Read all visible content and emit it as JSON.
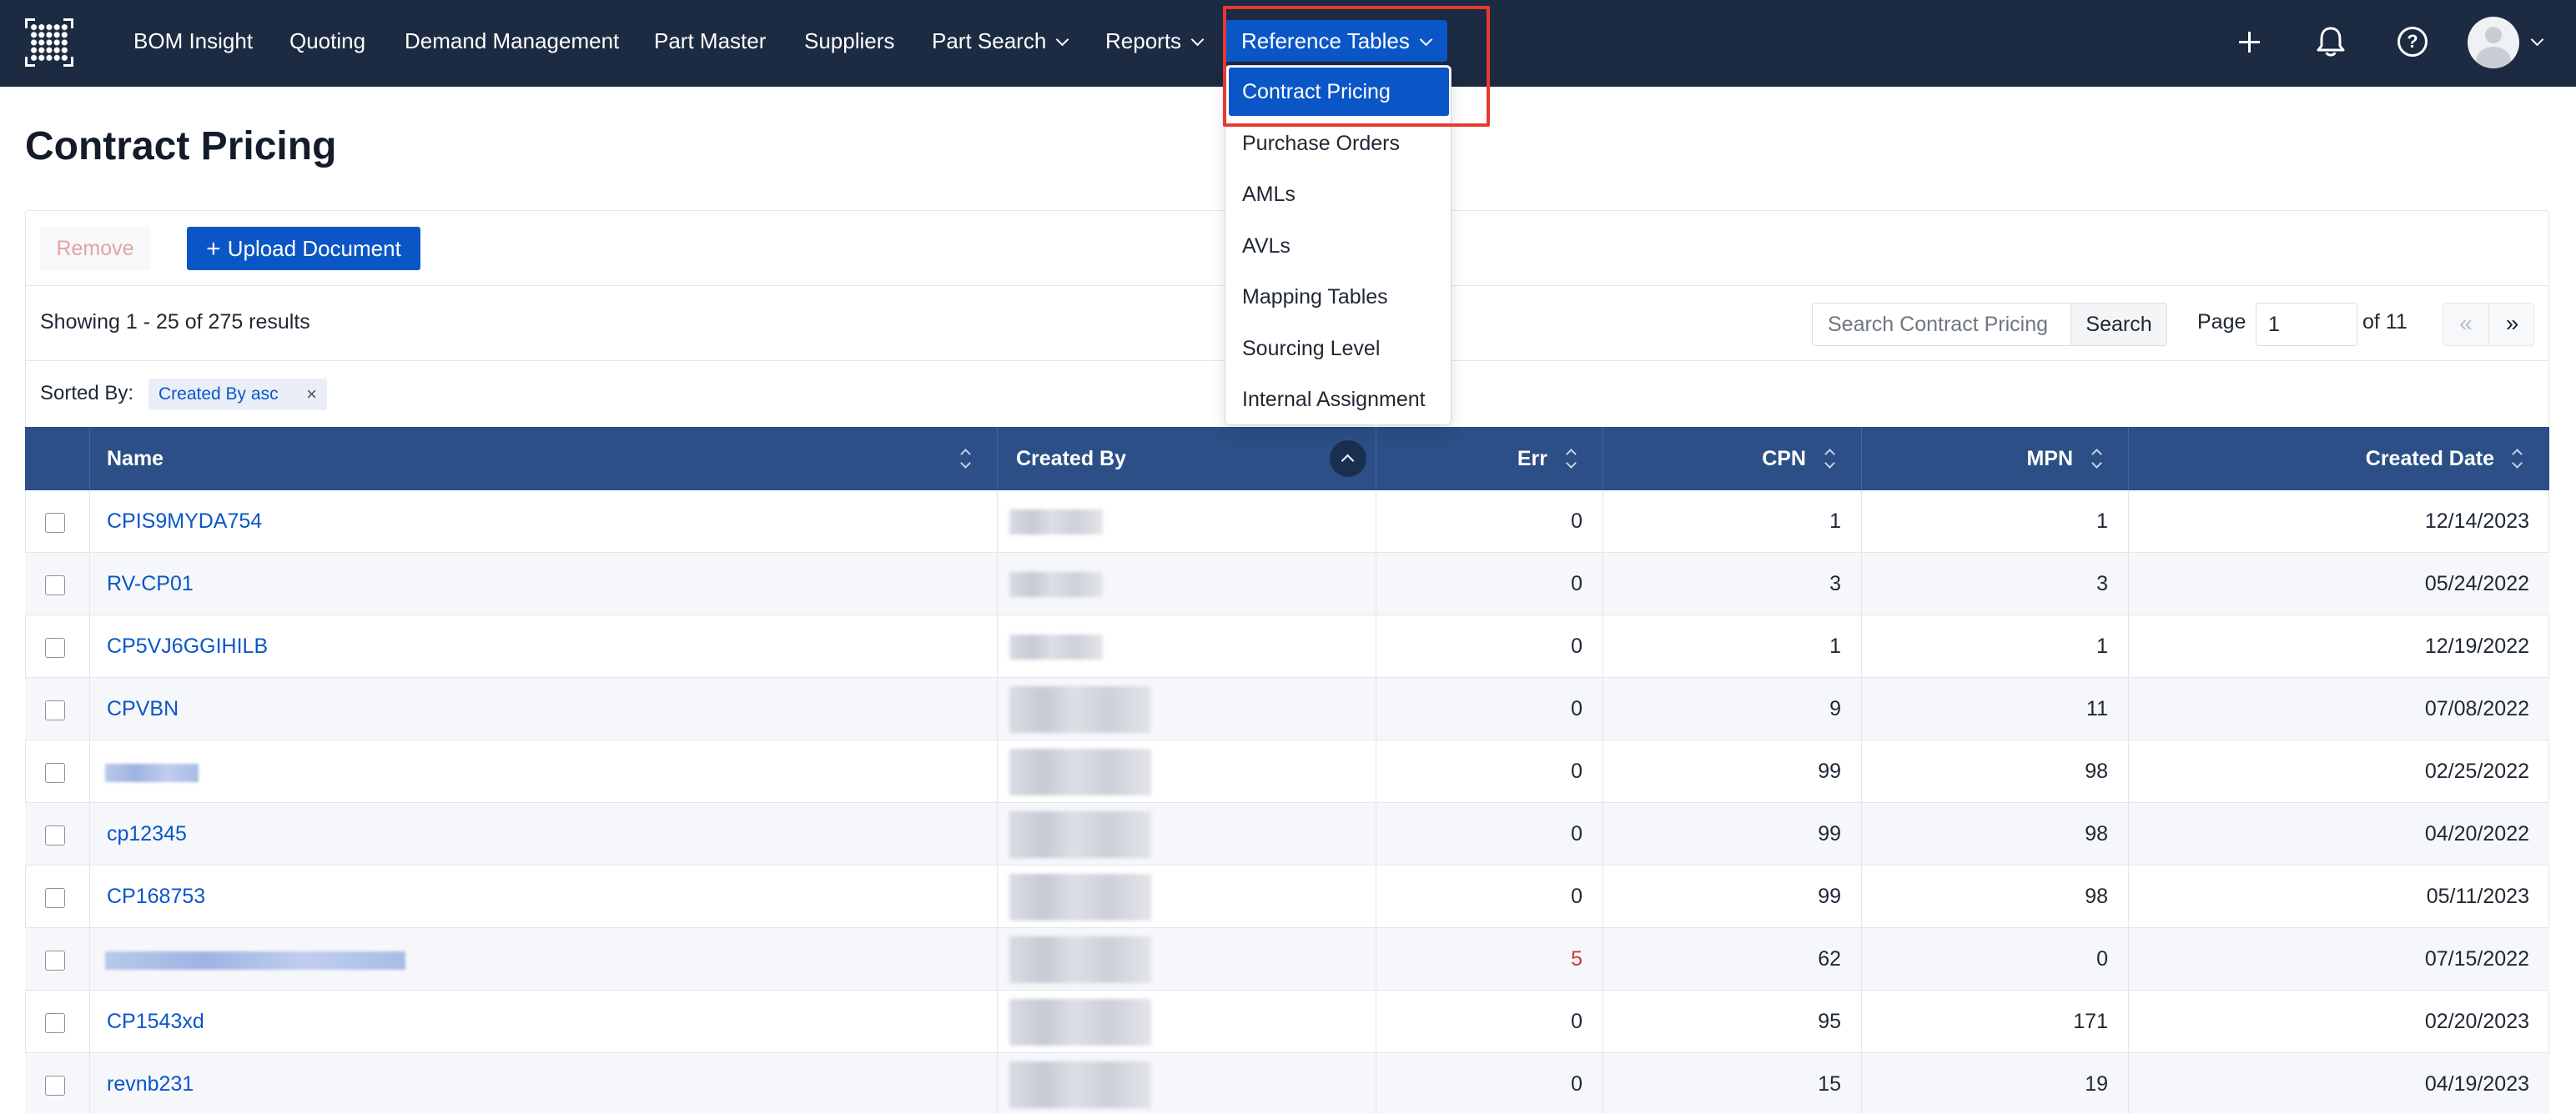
{
  "nav": {
    "items": [
      "BOM Insight",
      "Quoting",
      "Demand Management",
      "Part Master",
      "Suppliers",
      "Part Search",
      "Reports"
    ],
    "active": "Reference Tables"
  },
  "dropdown": {
    "items": [
      "Contract Pricing",
      "Purchase Orders",
      "AMLs",
      "AVLs",
      "Mapping Tables",
      "Sourcing Level",
      "Internal Assignment"
    ]
  },
  "page": {
    "title": "Contract Pricing",
    "remove_label": "Remove",
    "upload_label": "Upload Document",
    "showing": "Showing 1 - 25 of 275 results",
    "search_placeholder": "Search Contract Pricing",
    "search_label": "Search",
    "page_label": "Page",
    "page_value": "1",
    "page_of": "of 11",
    "prev_label": "«",
    "next_label": "»",
    "sorted_label": "Sorted By:",
    "sort_tag": "Created By asc",
    "sort_tag_close": "×"
  },
  "table": {
    "headers": [
      "Name",
      "Created By",
      "Err",
      "CPN",
      "MPN",
      "Created Date"
    ],
    "rows": [
      {
        "name": "CPIS9MYDA754",
        "err": "0",
        "cpn": "1",
        "mpn": "1",
        "date": "12/14/2023"
      },
      {
        "name": "RV-CP01",
        "err": "0",
        "cpn": "3",
        "mpn": "3",
        "date": "05/24/2022"
      },
      {
        "name": "CP5VJ6GGIHILB",
        "err": "0",
        "cpn": "1",
        "mpn": "1",
        "date": "12/19/2022"
      },
      {
        "name": "CPVBN",
        "err": "0",
        "cpn": "9",
        "mpn": "11",
        "date": "07/08/2022"
      },
      {
        "name": "",
        "err": "0",
        "cpn": "99",
        "mpn": "98",
        "date": "02/25/2022"
      },
      {
        "name": "cp12345",
        "err": "0",
        "cpn": "99",
        "mpn": "98",
        "date": "04/20/2022"
      },
      {
        "name": "CP168753",
        "err": "0",
        "cpn": "99",
        "mpn": "98",
        "date": "05/11/2023"
      },
      {
        "name": "",
        "err": "5",
        "cpn": "62",
        "mpn": "0",
        "date": "07/15/2022"
      },
      {
        "name": "CP1543xd",
        "err": "0",
        "cpn": "95",
        "mpn": "171",
        "date": "02/20/2023"
      },
      {
        "name": "revnb231",
        "err": "0",
        "cpn": "15",
        "mpn": "19",
        "date": "04/19/2023"
      }
    ]
  },
  "colors": {
    "nav_bg": "#1c2a42",
    "accent": "#0b56c6",
    "table_header": "#2b4f86",
    "error": "#d9342b",
    "highlight": "#e8392f"
  },
  "icons": [
    "grid-logo-icon",
    "plus-icon",
    "bell-icon",
    "help-icon",
    "user-avatar-icon",
    "chevron-down-icon",
    "sort-icon"
  ]
}
